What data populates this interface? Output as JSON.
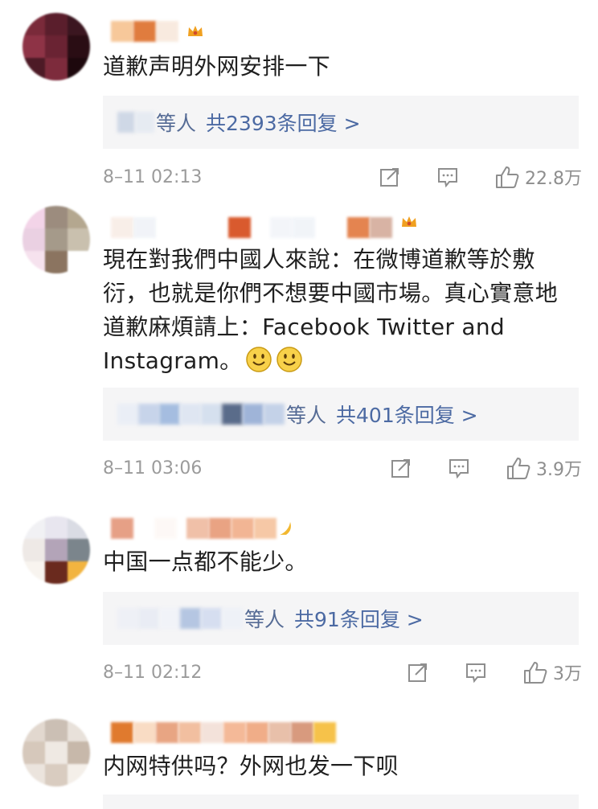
{
  "comments": [
    {
      "text": "道歉声明外网安排一下",
      "reply_who": "等人",
      "reply_count": "共2393条回复 >",
      "time": "8–11 02:13",
      "likes": "22.8万",
      "vip_icon": "crown-icon"
    },
    {
      "text": "現在對我們中國人來說：在微博道歉等於敷衍，也就是你們不想要中國市場。真心實意地道歉麻煩請上：Facebook Twitter and Instagram。",
      "reply_who": "等人",
      "reply_count": "共401条回复 >",
      "time": "8–11 03:06",
      "likes": "3.9万",
      "vip_icon": "crown-icon"
    },
    {
      "text": "中国一点都不能少。",
      "reply_who": "等人",
      "reply_count": "共91条回复 >",
      "time": "8–11 02:12",
      "likes": "3万",
      "vip_icon": "badge-icon"
    },
    {
      "text": "内网特供吗？外网也发一下呗"
    }
  ],
  "icons": {
    "repost": "repost-icon",
    "comment": "comment-icon",
    "like": "like-icon",
    "smile": "smile-emoji-icon"
  },
  "colors": {
    "link": "#556b95",
    "meta": "#9b9b9b",
    "reply_bg": "#f5f5f6",
    "vip": "#f0a020"
  }
}
